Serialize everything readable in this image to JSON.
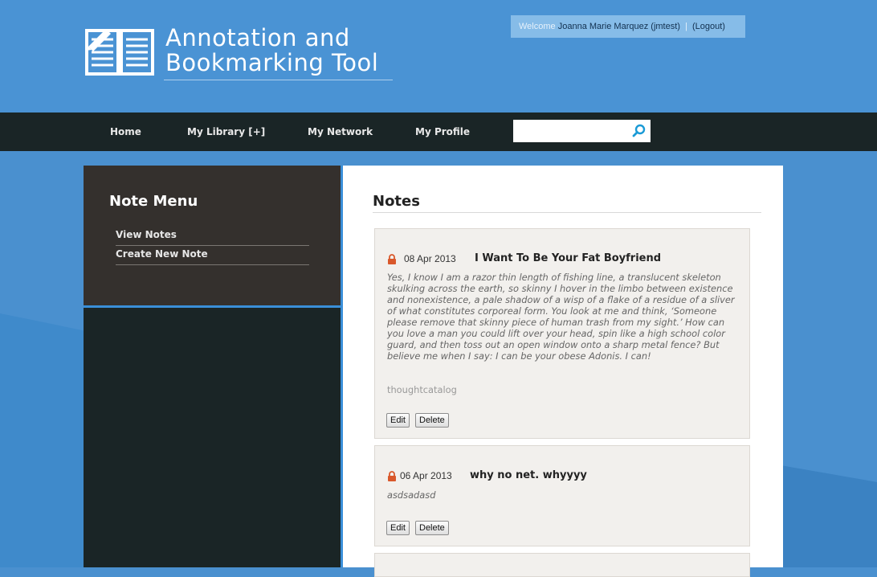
{
  "header": {
    "logo_line1": "Annotation and",
    "logo_line2": "Bookmarking Tool",
    "welcome_label": "Welcome",
    "user_name": "Joanna Marie Marquez (jmtest)",
    "separator": "|",
    "logout_label": "(Logout)"
  },
  "nav": {
    "items": [
      {
        "label": "Home"
      },
      {
        "label": "My Library [+]"
      },
      {
        "label": "My Network"
      },
      {
        "label": "My Profile"
      }
    ],
    "search_value": "",
    "search_icon": "magnifier-icon"
  },
  "sidebar": {
    "title": "Note Menu",
    "items": [
      {
        "label": "View Notes"
      },
      {
        "label": "Create New Note"
      }
    ]
  },
  "main": {
    "title": "Notes",
    "notes": [
      {
        "date": "08 Apr 2013",
        "title": "I Want To Be Your Fat Boyfriend",
        "body": "Yes, I know I am a razor thin length of fishing line, a translucent skeleton skulking across the earth, so skinny I hover in the limbo between existence and nonexistence, a pale shadow of a wisp of a flake of a residue of a sliver of what constitutes corporeal form. You look at me and think, ‘Someone please remove that skinny piece of human trash from my sight.’ How can you love a man you could lift over your head, spin like a high school color guard, and then toss out an open window onto a sharp metal fence? But believe me when I say: I can be your obese Adonis. I can!",
        "source": "thoughtcatalog",
        "edit_label": "Edit",
        "delete_label": "Delete"
      },
      {
        "date": "06 Apr 2013",
        "title": "why no net. whyyyy",
        "body": "asdsadasd",
        "source": "",
        "edit_label": "Edit",
        "delete_label": "Delete"
      }
    ]
  },
  "colors": {
    "background": "#4a90cf",
    "navbar": "#1a2526",
    "sidebar_top": "#34302d",
    "accent_blue": "#3a8fd8",
    "lock": "#d9582b"
  }
}
